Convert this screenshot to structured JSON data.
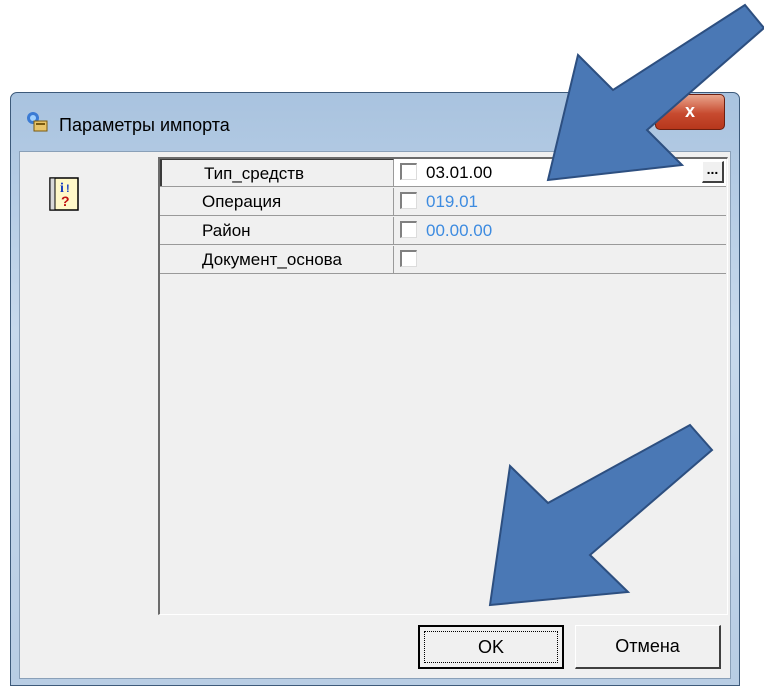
{
  "window": {
    "title": "Параметры импорта",
    "close_label": "x"
  },
  "grid": {
    "rows": [
      {
        "name": "Тип_средств",
        "value": "03.01.00",
        "value_color": "black",
        "selected": true,
        "has_ellipsis": true
      },
      {
        "name": "Операция",
        "value": "019.01",
        "value_color": "blue",
        "selected": false
      },
      {
        "name": "Район",
        "value": "00.00.00",
        "value_color": "blue",
        "selected": false
      },
      {
        "name": "Документ_основа",
        "value": "",
        "value_color": "black",
        "selected": false
      }
    ],
    "ellipsis_label": "..."
  },
  "buttons": {
    "ok_label": "OK",
    "cancel_label": "Отмена"
  },
  "colors": {
    "arrow": "#4a78b5",
    "blue_value": "#3d8be0"
  },
  "icons": [
    "app-icon",
    "help-icon",
    "close-icon",
    "ellipsis-icon"
  ]
}
